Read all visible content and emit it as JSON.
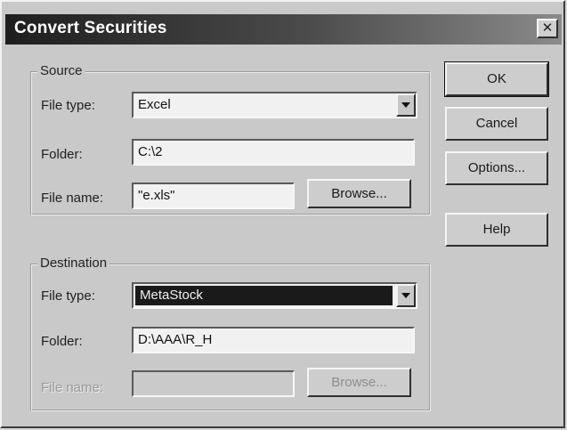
{
  "window": {
    "title": "Convert Securities",
    "close_glyph": "✕"
  },
  "source": {
    "group_label": "Source",
    "file_type_label": "File type:",
    "file_type_value": "Excel",
    "folder_label": "Folder:",
    "folder_value": "C:\\2",
    "file_name_label": "File name:",
    "file_name_value": "\"e.xls\"",
    "browse_label": "Browse..."
  },
  "destination": {
    "group_label": "Destination",
    "file_type_label": "File type:",
    "file_type_value": "MetaStock",
    "folder_label": "Folder:",
    "folder_value": "D:\\AAA\\R_H",
    "file_name_label": "File name:",
    "file_name_value": "",
    "browse_label": "Browse..."
  },
  "buttons": {
    "ok": "OK",
    "cancel": "Cancel",
    "options": "Options...",
    "help": "Help"
  },
  "icons": {
    "close": "close-icon",
    "dropdown": "chevron-down-icon"
  }
}
